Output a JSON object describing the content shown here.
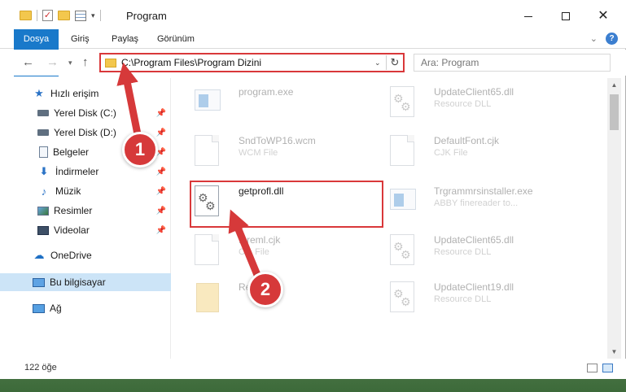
{
  "window": {
    "title": "Program"
  },
  "ribbon": {
    "tabs": [
      "Dosya",
      "Giriş",
      "Paylaş",
      "Görünüm"
    ]
  },
  "nav": {
    "address": "C:\\Program Files\\Program Dizini",
    "search_placeholder": "Ara: Program"
  },
  "sidebar": {
    "items": [
      {
        "label": "Hızlı erişim",
        "icon": "star-icon"
      },
      {
        "label": "Yerel Disk (C:)",
        "icon": "drive-icon",
        "pinned": true
      },
      {
        "label": "Yerel Disk (D:)",
        "icon": "drive-icon",
        "pinned": true
      },
      {
        "label": "Belgeler",
        "icon": "document-icon",
        "pinned": true
      },
      {
        "label": "İndirmeler",
        "icon": "download-icon",
        "pinned": true
      },
      {
        "label": "Müzik",
        "icon": "music-icon",
        "pinned": true
      },
      {
        "label": "Resimler",
        "icon": "pictures-icon",
        "pinned": true
      },
      {
        "label": "Videolar",
        "icon": "videos-icon",
        "pinned": true
      },
      {
        "label": "OneDrive",
        "icon": "cloud-icon"
      },
      {
        "label": "Bu bilgisayar",
        "icon": "computer-icon",
        "selected": true
      },
      {
        "label": "Ağ",
        "icon": "network-icon"
      }
    ]
  },
  "files": {
    "left": [
      {
        "name": "program.exe",
        "type": ""
      },
      {
        "name": "SndToWP16.wcm",
        "type": "WCM File"
      },
      {
        "name": "getprofl.dll",
        "type": ""
      },
      {
        "name": "...reml.cjk",
        "type": "C... File"
      },
      {
        "name": "Re...",
        "type": ""
      }
    ],
    "right": [
      {
        "name": "UpdateClient65.dll",
        "type": "Resource DLL"
      },
      {
        "name": "DefaultFont.cjk",
        "type": "CJK File"
      },
      {
        "name": "Trgrammrsinstaller.exe",
        "type": "ABBY finereader to..."
      },
      {
        "name": "UpdateClient65.dll",
        "type": "Resource DLL"
      },
      {
        "name": "UpdateClient19.dll",
        "type": "Resource DLL"
      }
    ]
  },
  "status": {
    "count": "122 öğe"
  },
  "annotations": {
    "badge1": "1",
    "badge2": "2"
  },
  "colors": {
    "accent": "#1979ca",
    "highlight": "#d9383a",
    "selection": "#cce4f7"
  }
}
